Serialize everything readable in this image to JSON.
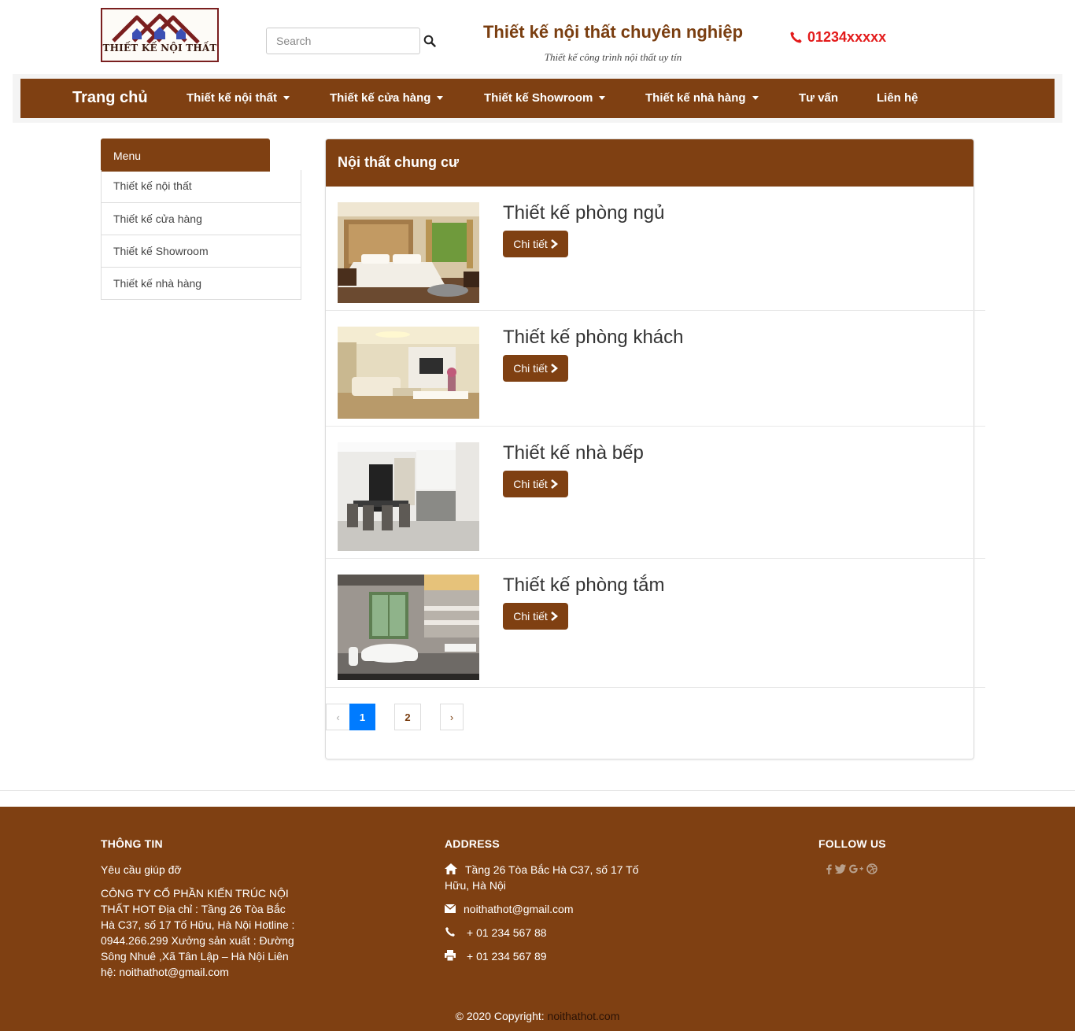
{
  "header": {
    "logo_text": "THIẾT KẾ NỘI THẤT",
    "search_placeholder": "Search",
    "site_title": "Thiết kế nội thất chuyên nghiệp",
    "site_subtitle": "Thiết kế công trình nội thất uy tín",
    "phone": "01234xxxxx"
  },
  "nav": {
    "brand": "Trang chủ",
    "items": [
      {
        "label": "Thiết kế nội thất",
        "dropdown": true
      },
      {
        "label": "Thiết kế cửa hàng",
        "dropdown": true
      },
      {
        "label": "Thiết kế Showroom",
        "dropdown": true
      },
      {
        "label": "Thiết kế nhà hàng",
        "dropdown": true
      },
      {
        "label": "Tư vấn",
        "dropdown": false
      },
      {
        "label": "Liên hệ",
        "dropdown": false
      }
    ]
  },
  "sidebar": {
    "title": "Menu",
    "items": [
      {
        "label": "Thiết kế nội thất"
      },
      {
        "label": "Thiết kế cửa hàng"
      },
      {
        "label": "Thiết kế Showroom"
      },
      {
        "label": "Thiết kế nhà hàng"
      }
    ]
  },
  "main": {
    "title": "Nội thất chung cư",
    "items": [
      {
        "title": "Thiết kế phòng ngủ",
        "button": "Chi tiết"
      },
      {
        "title": "Thiết kế phòng khách",
        "button": "Chi tiết"
      },
      {
        "title": "Thiết kế nhà bếp",
        "button": "Chi tiết"
      },
      {
        "title": "Thiết kế phòng tắm",
        "button": "Chi tiết"
      }
    ],
    "pagination": {
      "prev": "‹",
      "pages": [
        "1",
        "2"
      ],
      "current": "1",
      "next": "›"
    }
  },
  "footer": {
    "info": {
      "heading": "THÔNG TIN",
      "help": "Yêu cầu giúp đỡ",
      "company": "CÔNG TY CỔ PHẦN KIẾN TRÚC NỘI THẤT HOT Địa chỉ : Tầng 26 Tòa Bắc Hà C37, số 17 Tố Hữu, Hà Nội Hotline : 0944.266.299 Xưởng sản xuất : Đường Sông Nhuê ,Xã Tân Lập – Hà Nội Liên hệ: noithathot@gmail.com"
    },
    "address": {
      "heading": "ADDRESS",
      "location": "Tầng 26 Tòa Bắc Hà C37, số 17 Tố Hữu, Hà Nội",
      "email": "noithathot@gmail.com",
      "phone": "+ 01 234 567 88",
      "fax": "+ 01 234 567 89"
    },
    "follow": {
      "heading": "FOLLOW US",
      "icons": [
        "facebook-icon",
        "twitter-icon",
        "google-plus-icon",
        "dribbble-icon"
      ]
    },
    "copyright_prefix": "© 2020 Copyright:",
    "copyright_link": "noithathot.com"
  },
  "colors": {
    "brand": "#7f4012",
    "phone": "#e31b1b",
    "page_active": "#007bff"
  }
}
